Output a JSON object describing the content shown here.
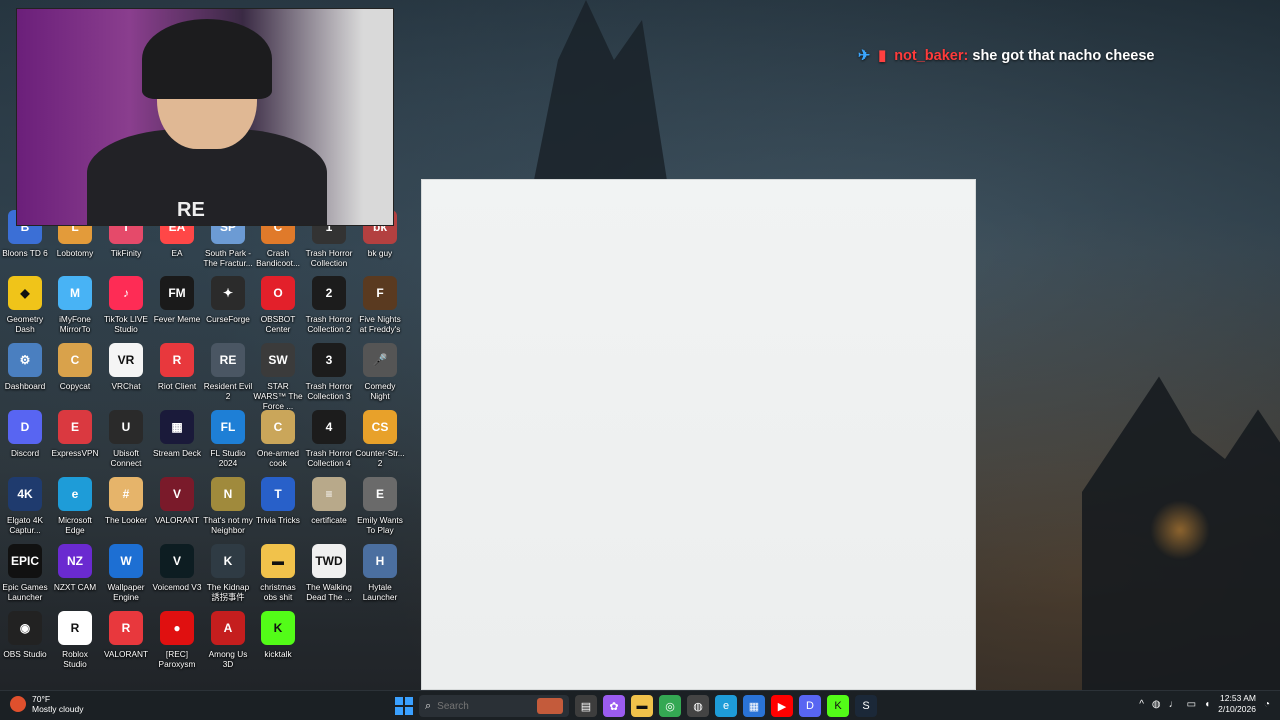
{
  "chat": {
    "username": "not_baker:",
    "message": "she got that nacho cheese",
    "badge_a": "✈",
    "badge_b": "▮"
  },
  "webcam": {
    "shirt_logo": "RE"
  },
  "desktop_icons": [
    {
      "label": "Bloons TD 6",
      "icon": "bloons-icon",
      "color": "#3b6fd6",
      "glyph": "B"
    },
    {
      "label": "Lobotomy",
      "icon": "lobotomy-icon",
      "color": "#e39b3a",
      "glyph": "L"
    },
    {
      "label": "TikFinity",
      "icon": "tikfinity-icon",
      "color": "#e54a6a",
      "glyph": "T"
    },
    {
      "label": "EA",
      "icon": "ea-icon",
      "color": "#ff4747",
      "glyph": "EA"
    },
    {
      "label": "South Park - The Fractur...",
      "icon": "southpark-icon",
      "color": "#6c9bd4",
      "glyph": "SP"
    },
    {
      "label": "Crash Bandicoot...",
      "icon": "crash-icon",
      "color": "#e07a2a",
      "glyph": "C"
    },
    {
      "label": "Trash Horror Collection",
      "icon": "trash-horror-icon",
      "color": "#333",
      "glyph": "1"
    },
    {
      "label": "bk guy",
      "icon": "bk-guy-icon",
      "color": "#b34040",
      "glyph": "bk"
    },
    {
      "label": "Geometry Dash",
      "icon": "geometry-dash-icon",
      "color": "#f0c419",
      "glyph": "◆"
    },
    {
      "label": "iMyFone MirrorTo",
      "icon": "mirrorto-icon",
      "color": "#48b3f5",
      "glyph": "M"
    },
    {
      "label": "TikTok LIVE Studio",
      "icon": "tiktok-icon",
      "color": "#fe2c55",
      "glyph": "♪"
    },
    {
      "label": "Fever Meme",
      "icon": "fever-meme-icon",
      "color": "#1a1a1a",
      "glyph": "FM"
    },
    {
      "label": "CurseForge",
      "icon": "curseforge-icon",
      "color": "#2b2b2b",
      "glyph": "✦"
    },
    {
      "label": "OBSBOT Center",
      "icon": "obsbot-icon",
      "color": "#e3202a",
      "glyph": "O"
    },
    {
      "label": "Trash Horror Collection 2",
      "icon": "trash-horror-2-icon",
      "color": "#1c1c1c",
      "glyph": "2"
    },
    {
      "label": "Five Nights at Freddy's",
      "icon": "fnaf-icon",
      "color": "#5a3a20",
      "glyph": "F"
    },
    {
      "label": "Dashboard",
      "icon": "dashboard-icon",
      "color": "#4a7fc0",
      "glyph": "⚙"
    },
    {
      "label": "Copycat",
      "icon": "copycat-icon",
      "color": "#d9a24b",
      "glyph": "C"
    },
    {
      "label": "VRChat",
      "icon": "vrchat-icon",
      "color": "#f5f5f5",
      "glyph": "VR"
    },
    {
      "label": "Riot Client",
      "icon": "riot-client-icon",
      "color": "#e8383d",
      "glyph": "R"
    },
    {
      "label": "Resident Evil 2",
      "icon": "re2-icon",
      "color": "#4a5663",
      "glyph": "RE"
    },
    {
      "label": "STAR WARS™ The Force ...",
      "icon": "starwars-icon",
      "color": "#3b3b3b",
      "glyph": "SW"
    },
    {
      "label": "Trash Horror Collection 3",
      "icon": "trash-horror-3-icon",
      "color": "#1c1c1c",
      "glyph": "3"
    },
    {
      "label": "Comedy Night",
      "icon": "comedy-night-icon",
      "color": "#555",
      "glyph": "🎤"
    },
    {
      "label": "Discord",
      "icon": "discord-icon",
      "color": "#5865f2",
      "glyph": "D"
    },
    {
      "label": "ExpressVPN",
      "icon": "expressvpn-icon",
      "color": "#da3940",
      "glyph": "E"
    },
    {
      "label": "Ubisoft Connect",
      "icon": "ubisoft-icon",
      "color": "#2a2a2a",
      "glyph": "U"
    },
    {
      "label": "Stream Deck",
      "icon": "stream-deck-icon",
      "color": "#1a1a3a",
      "glyph": "▦"
    },
    {
      "label": "FL Studio 2024",
      "icon": "fl-studio-icon",
      "color": "#1e7fd6",
      "glyph": "FL"
    },
    {
      "label": "One-armed cook",
      "icon": "one-armed-cook-icon",
      "color": "#caa65a",
      "glyph": "C"
    },
    {
      "label": "Trash Horror Collection 4",
      "icon": "trash-horror-4-icon",
      "color": "#1c1c1c",
      "glyph": "4"
    },
    {
      "label": "Counter-Str... 2",
      "icon": "cs2-icon",
      "color": "#e8a12a",
      "glyph": "CS"
    },
    {
      "label": "Elgato 4K Captur...",
      "icon": "elgato-icon",
      "color": "#1f3b6e",
      "glyph": "4K"
    },
    {
      "label": "Microsoft Edge",
      "icon": "edge-icon",
      "color": "#1e9cd8",
      "glyph": "e"
    },
    {
      "label": "The Looker",
      "icon": "looker-icon",
      "color": "#e6b46a",
      "glyph": "#"
    },
    {
      "label": "VALORANT",
      "icon": "valorant-icon",
      "color": "#7a1a2a",
      "glyph": "V"
    },
    {
      "label": "That's not my Neighbor",
      "icon": "neighbor-icon",
      "color": "#a08a3c",
      "glyph": "N"
    },
    {
      "label": "Trivia Tricks",
      "icon": "trivia-icon",
      "color": "#2860c9",
      "glyph": "T"
    },
    {
      "label": "certificate",
      "icon": "certificate-icon",
      "color": "#b8a98a",
      "glyph": "≡"
    },
    {
      "label": "Emily Wants To Play",
      "icon": "emily-icon",
      "color": "#6a6a6a",
      "glyph": "E"
    },
    {
      "label": "Epic Games Launcher",
      "icon": "epic-games-icon",
      "color": "#111",
      "glyph": "EPIC"
    },
    {
      "label": "NZXT CAM",
      "icon": "nzxt-icon",
      "color": "#6a2ad0",
      "glyph": "NZ"
    },
    {
      "label": "Wallpaper Engine",
      "icon": "wallpaper-engine-icon",
      "color": "#1d6fd3",
      "glyph": "W"
    },
    {
      "label": "Voicemod V3",
      "icon": "voicemod-icon",
      "color": "#0d1d22",
      "glyph": "V"
    },
    {
      "label": "The Kidnap 誘拐事件",
      "icon": "kidnap-icon",
      "color": "#2f3b44",
      "glyph": "K"
    },
    {
      "label": "christmas obs shit",
      "icon": "folder-icon",
      "color": "#f1c24b",
      "glyph": "▬"
    },
    {
      "label": "The Walking Dead The ...",
      "icon": "walking-dead-icon",
      "color": "#f0f0f0",
      "glyph": "TWD"
    },
    {
      "label": "Hytale Launcher",
      "icon": "hytale-icon",
      "color": "#4b6fa0",
      "glyph": "H"
    },
    {
      "label": "OBS Studio",
      "icon": "obs-icon",
      "color": "#222",
      "glyph": "◉"
    },
    {
      "label": "Roblox Studio",
      "icon": "roblox-icon",
      "color": "#fff",
      "glyph": "R"
    },
    {
      "label": "VALORANT",
      "icon": "valorant-riot-icon",
      "color": "#e8383d",
      "glyph": "R"
    },
    {
      "label": "[REC] Paroxysm",
      "icon": "rec-paroxysm-icon",
      "color": "#e01010",
      "glyph": "●"
    },
    {
      "label": "Among Us 3D",
      "icon": "among-us-icon",
      "color": "#c51e1e",
      "glyph": "A"
    },
    {
      "label": "kicktalk",
      "icon": "kicktalk-icon",
      "color": "#53fc18",
      "glyph": "K"
    }
  ],
  "taskbar": {
    "weather_temp": "70°F",
    "weather_desc": "Mostly cloudy",
    "search_placeholder": "Search",
    "apps": [
      {
        "name": "file-explorer-icon",
        "color": "#3d3d3d",
        "glyph": "▤"
      },
      {
        "name": "copilot-icon",
        "color": "#9b5cf0",
        "glyph": "✿"
      },
      {
        "name": "folder-icon",
        "color": "#f1c24b",
        "glyph": "▬"
      },
      {
        "name": "chrome-icon",
        "color": "#34a853",
        "glyph": "◎"
      },
      {
        "name": "app-icon",
        "color": "#444",
        "glyph": "◍"
      },
      {
        "name": "edge-icon",
        "color": "#1e9cd8",
        "glyph": "e"
      },
      {
        "name": "store-icon",
        "color": "#2a73d6",
        "glyph": "▦"
      },
      {
        "name": "youtube-icon",
        "color": "#ff0000",
        "glyph": "▶"
      },
      {
        "name": "discord-icon",
        "color": "#5865f2",
        "glyph": "D"
      },
      {
        "name": "kick-icon",
        "color": "#53fc18",
        "glyph": "K"
      },
      {
        "name": "steam-icon",
        "color": "#1b2838",
        "glyph": "S"
      }
    ],
    "time": "12:53 AM",
    "date": "2/10/2026"
  }
}
